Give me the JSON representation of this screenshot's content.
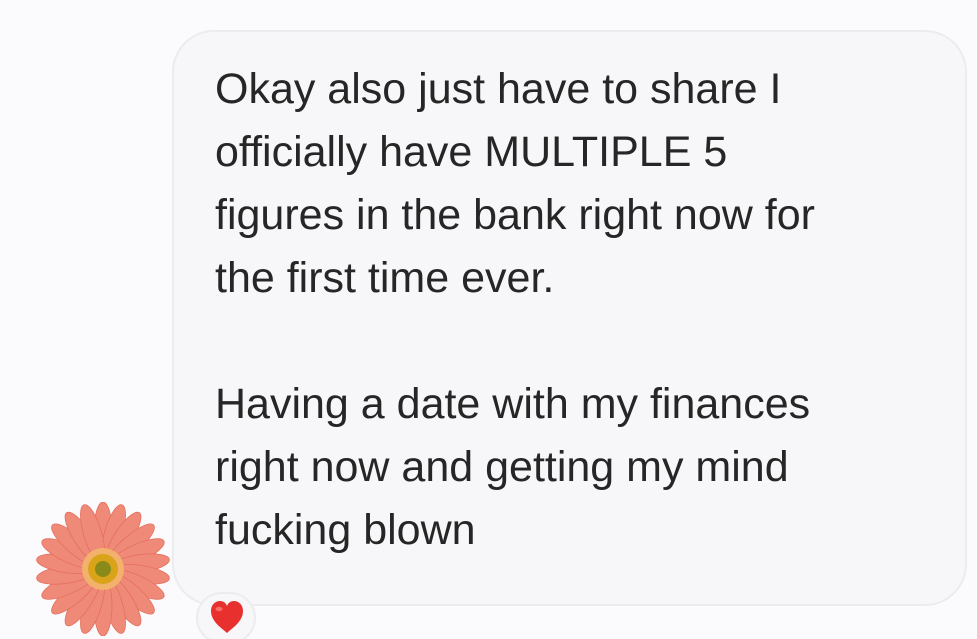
{
  "message": {
    "paragraph1": "Okay also just have to share I\nofficially have MULTIPLE 5\nfigures in the bank right now for\nthe first time ever.",
    "paragraph2": "Having a date with my finances\nright now and getting my mind\nfucking blown"
  },
  "avatar": {
    "icon": "gerbera-daisy-icon",
    "petal_color": "#f08a78",
    "center_color": "#d9a41a"
  },
  "reaction": {
    "icon": "red-heart-icon",
    "color": "#e8302f"
  }
}
